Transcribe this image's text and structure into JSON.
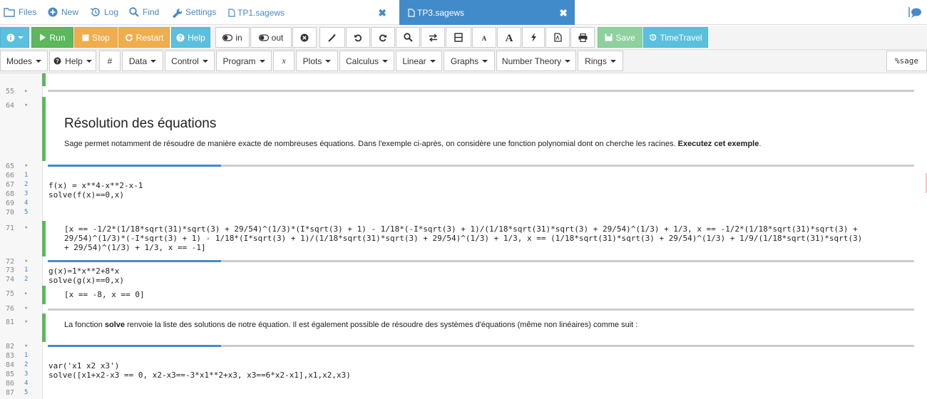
{
  "topnav": {
    "files": "Files",
    "new": "New",
    "log": "Log",
    "find": "Find",
    "settings": "Settings",
    "tabs": [
      {
        "label": "TP1.sagews",
        "close": "✖"
      },
      {
        "label": "TP3.sagews",
        "close": "✖"
      }
    ]
  },
  "toolbar": {
    "run": "Run",
    "stop": "Stop",
    "restart": "Restart",
    "help": "Help",
    "in": "in",
    "out": "out",
    "save": "Save",
    "timetravel": "TimeTravel"
  },
  "menubar": {
    "modes": "Modes",
    "help": "Help",
    "hash": "#",
    "data": "Data",
    "control": "Control",
    "program": "Program",
    "x": "x",
    "plots": "Plots",
    "calculus": "Calculus",
    "linear": "Linear",
    "graphs": "Graphs",
    "number_theory": "Number Theory",
    "rings": "Rings",
    "mode_badge": "%sage"
  },
  "editor": {
    "line_numbers": {
      "l55": "55",
      "l64": "64",
      "l65": "65",
      "l66": "66",
      "l67": "67",
      "l68": "68",
      "l69": "69",
      "l70": "70",
      "l71": "71",
      "l72": "72",
      "l73": "73",
      "l74": "74",
      "l75": "75",
      "l76": "76",
      "l81": "81",
      "l82": "82",
      "l83": "83",
      "l84": "84",
      "l85": "85",
      "l86": "86",
      "l87": "87"
    },
    "rel_numbers": {
      "r1": "1",
      "r2": "2",
      "r3": "3",
      "r4": "4",
      "r5": "5"
    },
    "heading": "Résolution des équations",
    "intro": "Sage permet notamment de résoudre de manière exacte de nombreuses équations. Dans l'exemple ci-après, on considère une fonction polynomial dont on cherche les racines. ",
    "intro_bold": "Executez cet exemple",
    "intro_end": ".",
    "code1_line1": "f(x) = x**4-x**2-x-1",
    "code1_line2": "solve(f(x)==0,x)",
    "output1_line1": "[x == -1/2*(1/18*sqrt(31)*sqrt(3) + 29/54)^(1/3)*(I*sqrt(3) + 1) - 1/18*(-I*sqrt(3) + 1)/(1/18*sqrt(31)*sqrt(3) + 29/54)^(1/3) + 1/3, x == -1/2*(1/18*sqrt(31)*sqrt(3) +",
    "output1_line2": "29/54)^(1/3)*(-I*sqrt(3) + 1) - 1/18*(I*sqrt(3) + 1)/(1/18*sqrt(31)*sqrt(3) + 29/54)^(1/3) + 1/3, x == (1/18*sqrt(31)*sqrt(3) + 29/54)^(1/3) + 1/9/(1/18*sqrt(31)*sqrt(3)",
    "output1_line3": "+ 29/54)^(1/3) + 1/3, x == -1]",
    "code2_line1": "g(x)=1*x**2+8*x",
    "code2_line2": "solve(g(x)==0,x)",
    "output2": "[x == -8, x == 0]",
    "text2_pre": "La fonction ",
    "text2_bold": "solve",
    "text2_post": " renvoie la liste des solutions de notre équation. Il est également possible de résoudre des systèmes d'équations (même non linéaires) comme suit :",
    "code3_line1": "var('x1 x2 x3')",
    "code3_line2": "solve([x1+x2-x3 == 0, x2-x3==-3*x1**2+x3, x3==6*x2-x1],x1,x2,x3)",
    "progress": 0.2
  },
  "colors": {
    "accent": "#428bca",
    "run": "#5cb85c",
    "warn": "#f0ad4e",
    "info": "#5bc0de"
  }
}
